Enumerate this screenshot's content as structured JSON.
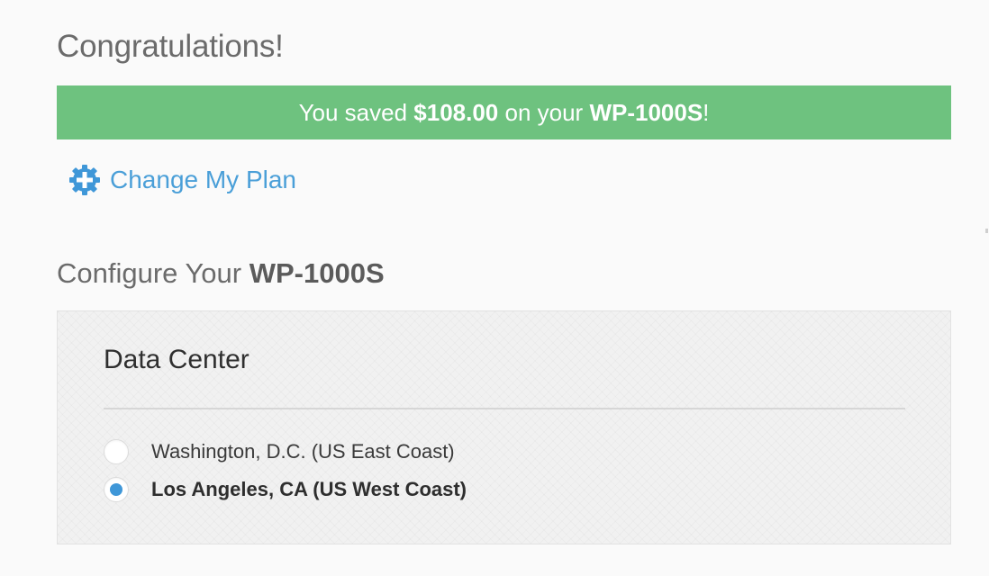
{
  "page": {
    "title": "Congratulations!"
  },
  "banner": {
    "prefix": "You saved ",
    "amount": "$108.00",
    "middle": " on your ",
    "product": "WP-1000S",
    "suffix": "!",
    "color": "#6ec27f"
  },
  "change_plan": {
    "label": "Change My Plan",
    "icon": "gear-plus-icon",
    "color": "#4a9fd8"
  },
  "configure": {
    "title_prefix": "Configure Your ",
    "product": "WP-1000S"
  },
  "data_center": {
    "heading": "Data Center",
    "options": [
      {
        "label": "Washington, D.C. (US East Coast)",
        "selected": false
      },
      {
        "label": "Los Angeles, CA (US West Coast)",
        "selected": true
      }
    ],
    "accent": "#3f97d8"
  }
}
